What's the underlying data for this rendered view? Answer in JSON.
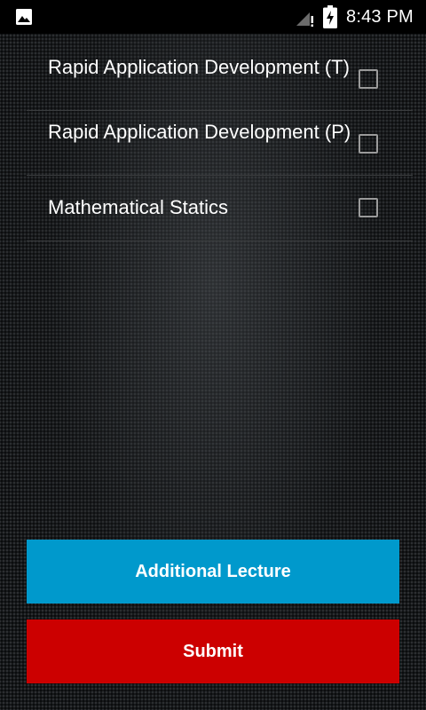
{
  "status_bar": {
    "time": "8:43 PM",
    "left_icon": "image-icon",
    "signal_icon": "signal-no-data-icon",
    "battery_icon": "battery-charging-icon"
  },
  "courses": [
    {
      "label": "Rapid Application Development (T)",
      "checked": false
    },
    {
      "label": "Rapid Application Development (P)",
      "checked": false
    },
    {
      "label": "Mathematical Statics",
      "checked": false
    }
  ],
  "buttons": {
    "additional_lecture": "Additional Lecture",
    "submit": "Submit"
  },
  "colors": {
    "additional_button": "#0099cc",
    "submit_button": "#cc0000"
  }
}
